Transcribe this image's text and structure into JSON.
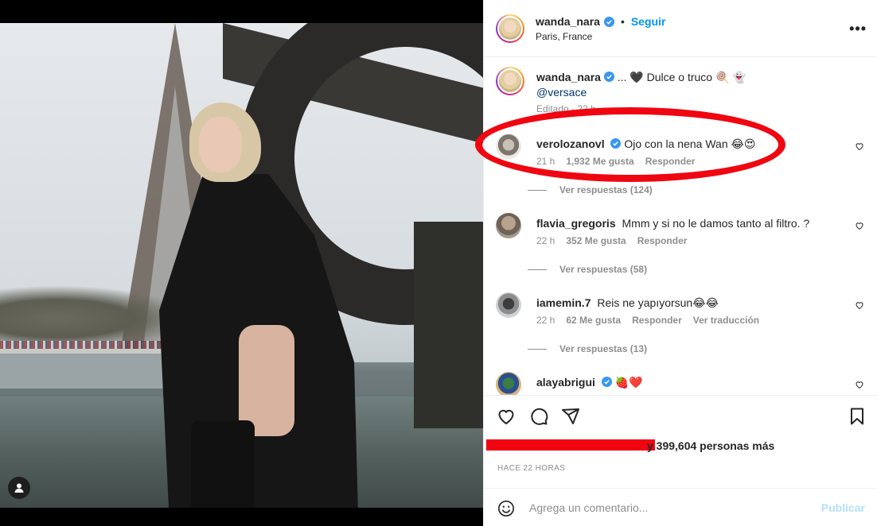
{
  "post": {
    "username": "wanda_nara",
    "follow_label": "Seguir",
    "location": "Paris, France",
    "more_label": "•••"
  },
  "caption": {
    "username": "wanda_nara",
    "text": "... 🖤 Dulce o truco 🍭 👻",
    "mention": "@versace",
    "edited": "Editado · 22 h"
  },
  "comments": [
    {
      "username": "verolozanovl",
      "verified": true,
      "text": "Ojo con la nena Wan 😂😍",
      "time": "21 h",
      "likes": "1,932 Me gusta",
      "reply": "Responder",
      "replies": "Ver respuestas (124)"
    },
    {
      "username": "flavia_gregoris",
      "verified": false,
      "text": "Mmm y si no le damos tanto al filtro. ?",
      "time": "22 h",
      "likes": "352 Me gusta",
      "reply": "Responder",
      "replies": "Ver respuestas (58)"
    },
    {
      "username": "iamemin.7",
      "verified": false,
      "text": "Reis ne yapıyorsun😂😂",
      "time": "22 h",
      "likes": "62 Me gusta",
      "reply": "Responder",
      "translate": "Ver traducción",
      "replies": "Ver respuestas (13)"
    },
    {
      "username": "alayabrigui",
      "verified": true,
      "text": "🍓❤️"
    }
  ],
  "likes_text": "y 399,604 personas más",
  "timestamp": "HACE 22 HORAS",
  "add_comment": {
    "placeholder": "Agrega un comentario...",
    "publish_label": "Publicar"
  },
  "colors": {
    "link_blue": "#0095f6",
    "verified_blue": "#3897f0",
    "annotation_red": "#f00610"
  }
}
